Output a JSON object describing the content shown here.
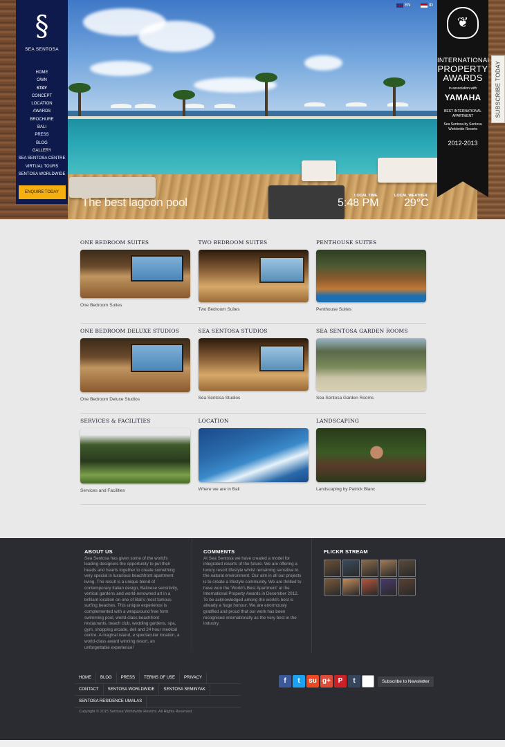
{
  "brand": {
    "logo_text": "SEA SENTOSA"
  },
  "nav": {
    "items": [
      "HOME",
      "OWN",
      "STAY",
      "CONCEPT",
      "LOCATION",
      "AWARDS",
      "BROCHURE",
      "BALI",
      "PRESS",
      "BLOG",
      "GALLERY",
      "SEA SENTOSA CENTRE",
      "VIRTUAL TOURS",
      "SENTOSA WORLDWIDE"
    ],
    "active": "STAY",
    "enquire": "ENQUIRE TODAY"
  },
  "lang": {
    "en": "EN",
    "id": "ID"
  },
  "award": {
    "line1": "INTERNATIONAL",
    "line2": "PROPERTY",
    "line3": "AWARDS",
    "assoc": "in association with",
    "sponsor": "YAMAHA",
    "category": "BEST INTERNATIONAL APARTMENT",
    "winner": "Sea Sentosa by Sentosa Worldwide Resorts",
    "year": "2012-2013"
  },
  "subscribe": "SUBSCRIBE TODAY",
  "hero": {
    "caption": "The best lagoon pool",
    "time_label": "LOCAL TIME",
    "time_value": "5:48 PM",
    "weather_label": "LOCAL WEATHER",
    "weather_value": "29°C"
  },
  "gallery": [
    [
      {
        "title": "ONE BEDROOM SUITES",
        "caption": "One Bedroom Suites",
        "thumb": "room"
      },
      {
        "title": "TWO BEDROOM SUITES",
        "caption": "Two Bedroom Suites",
        "thumb": "room2"
      },
      {
        "title": "PENTHOUSE SUITES",
        "caption": "Penthouse Suites",
        "thumb": "pent"
      }
    ],
    [
      {
        "title": "ONE BEDROOM DELUXE STUDIOS",
        "caption": "One Bedroom Deluxe Studios",
        "thumb": "room"
      },
      {
        "title": "SEA SENTOSA STUDIOS",
        "caption": "Sea Sentosa Studios",
        "thumb": "room2"
      },
      {
        "title": "SEA SENTOSA GARDEN ROOMS",
        "caption": "Sea Sentosa Garden Rooms",
        "thumb": "garden"
      }
    ],
    [
      {
        "title": "SERVICES & FACILITIES",
        "caption": "Services and Facilities",
        "thumb": "services"
      },
      {
        "title": "LOCATION",
        "caption": "Where we are in Bali",
        "thumb": "location"
      },
      {
        "title": "LANDSCAPING",
        "caption": "Landscaping by Patrick Blanc",
        "thumb": "land"
      }
    ]
  ],
  "footer": {
    "about": {
      "title": "ABOUT US",
      "text": "Sea Sentosa has given some of the world's leading designers the opportunity to put their heads and hearts together to create something very special in luxurious beachfront apartment living. The result is a unique blend of contemporary Italian design, Balinese sensitivity, vertical gardens and world-renowned art in a brilliant location on one of Bali's most famous surfing beaches. This unique experience is complemented with a wraparound free form swimming pool, world-class beachfront restaurants, beach club, wedding gardens, spa, gym, shopping arcade, deli and 24 hour medical centre. A magical island, a spectacular location, a world-class award winning resort, an unforgettable experience!"
    },
    "comments": {
      "title": "COMMENTS",
      "text": "At Sea Sentosa we have created a model for integrated resorts of the future. We are offering a luxury resort lifestyle whilst remaining sensitive to the natural environment. Our aim in all our projects is to create a lifestyle community. We are thrilled to have won the 'World's Best Apartment' at the International Property Awards in December 2012. To be acknowledged among the world's best is already a huge honour. We are enormously gratified and proud that our work has been recognised internationally as the very best in the industry."
    },
    "flickr": {
      "title": "FLICKR STREAM"
    },
    "links_row1": [
      "HOME",
      "BLOG",
      "PRESS",
      "TERMS OF USE",
      "PRIVACY"
    ],
    "links_row2": [
      "CONTACT",
      "SENTOSA WORLDWIDE",
      "SENTOSA SEMINYAK"
    ],
    "links_row3": [
      "SENTOSA RESIDENCE UMALAS"
    ],
    "copyright": "Copyright © 2015 Sentosa Worldwide Resorts. All Rights Reserved.",
    "newsletter": "Subscribe to Newsletter",
    "social": [
      {
        "name": "facebook-icon",
        "glyph": "f",
        "color": "#3b5998"
      },
      {
        "name": "twitter-icon",
        "glyph": "t",
        "color": "#1da1f2"
      },
      {
        "name": "stumbleupon-icon",
        "glyph": "su",
        "color": "#eb4924"
      },
      {
        "name": "googleplus-icon",
        "glyph": "g+",
        "color": "#dd4b39"
      },
      {
        "name": "pinterest-icon",
        "glyph": "P",
        "color": "#cb2027"
      },
      {
        "name": "tumblr-icon",
        "glyph": "t",
        "color": "#35465c"
      },
      {
        "name": "delicious-icon",
        "glyph": "",
        "color": "#ffffff"
      }
    ]
  }
}
